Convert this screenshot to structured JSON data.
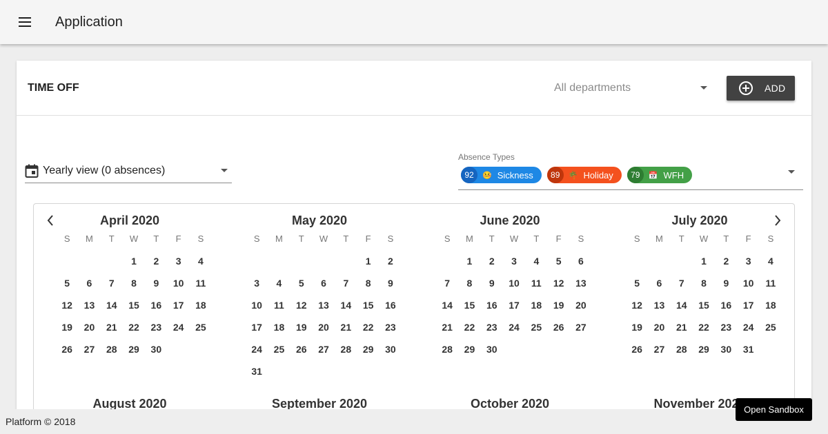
{
  "app": {
    "title": "Application"
  },
  "header": {
    "title": "TIME OFF",
    "department_placeholder": "All departments",
    "add_label": "ADD"
  },
  "view_select": {
    "value": "Yearly view (0 absences)"
  },
  "absence_types": {
    "label": "Absence Types",
    "chips": [
      {
        "count": "92",
        "emoji": "🤒",
        "name": "Sickness",
        "color": "#1e88e5",
        "count_color": "#1565c0"
      },
      {
        "count": "89",
        "emoji": "🌴",
        "name": "Holiday",
        "color": "#f4511e",
        "count_color": "#bf360c"
      },
      {
        "count": "79",
        "emoji": "📅",
        "name": "WFH",
        "color": "#43a047",
        "count_color": "#2e7d32"
      }
    ]
  },
  "weekdays": [
    "S",
    "M",
    "T",
    "W",
    "T",
    "F",
    "S"
  ],
  "months": [
    {
      "name": "April 2020",
      "offset": 3,
      "days": 30
    },
    {
      "name": "May 2020",
      "offset": 5,
      "days": 31
    },
    {
      "name": "June 2020",
      "offset": 1,
      "days": 30
    },
    {
      "name": "July 2020",
      "offset": 3,
      "days": 31
    },
    {
      "name": "August 2020"
    },
    {
      "name": "September 2020"
    },
    {
      "name": "October 2020"
    },
    {
      "name": "November 2020"
    }
  ],
  "footer": {
    "text": "Platform © 2018"
  },
  "sandbox_label": "Open Sandbox"
}
